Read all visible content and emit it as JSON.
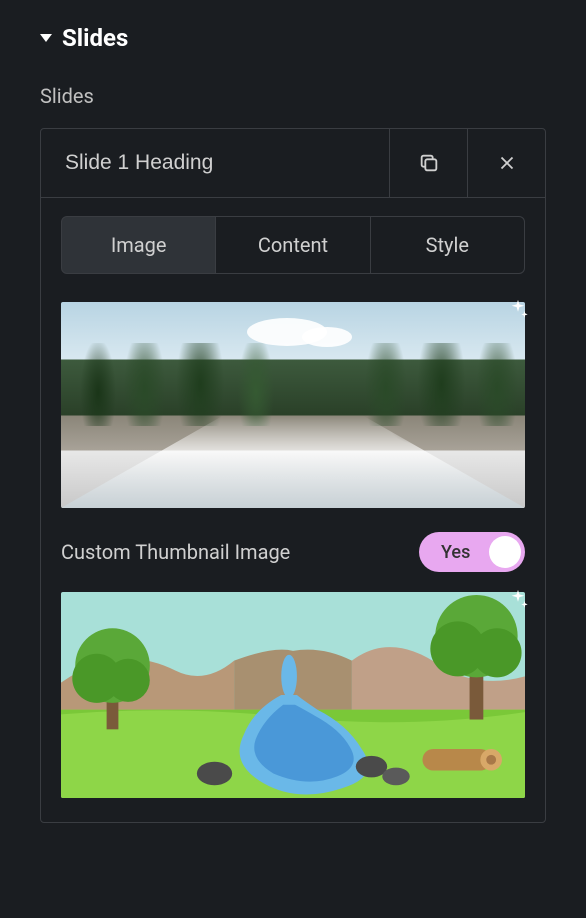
{
  "section": {
    "title": "Slides",
    "subsection_label": "Slides"
  },
  "slide": {
    "heading": "Slide 1 Heading",
    "tabs": {
      "image": "Image",
      "content": "Content",
      "style": "Style"
    },
    "custom_thumb": {
      "label": "Custom Thumbnail Image",
      "toggle_value": "Yes"
    }
  }
}
